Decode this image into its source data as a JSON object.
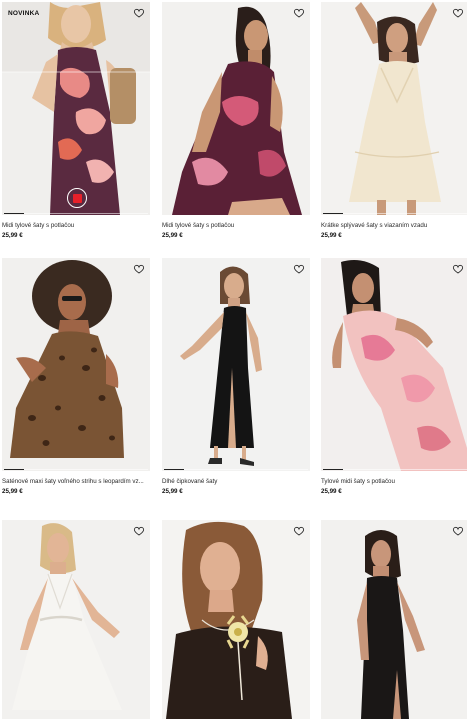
{
  "products": [
    {
      "name": "Midi tylové šaty s potlačou",
      "price": "25,99 €",
      "badge": "NOVINKA",
      "image": "woman-floral-tulle-dress",
      "progress": 0.14
    },
    {
      "name": "Midi tylové šaty s potlačou",
      "price": "25,99 €",
      "badge": "",
      "image": "woman-sitting-floral-dress",
      "progress": 0
    },
    {
      "name": "Krátke splývavé šaty s viazaním vzadu",
      "price": "25,99 €",
      "badge": "",
      "image": "woman-cream-short-dress",
      "progress": 0.14
    },
    {
      "name": "Saténové maxi šaty voľného strihu s leopardím vz...",
      "price": "25,99 €",
      "badge": "",
      "image": "woman-leopard-dress",
      "progress": 0.14
    },
    {
      "name": "Dlhé čipkované šaty",
      "price": "25,99 €",
      "badge": "",
      "image": "woman-black-lace-dress",
      "progress": 0.14
    },
    {
      "name": "Tylové midi šaty s potlačou",
      "price": "25,99 €",
      "badge": "",
      "image": "woman-pink-print-dress",
      "progress": 0.14
    },
    {
      "name": "",
      "price": "",
      "badge": "",
      "image": "woman-white-halter-dress",
      "progress": 0
    },
    {
      "name": "",
      "price": "",
      "badge": "",
      "image": "woman-black-dress-flower-necklace",
      "progress": 0
    },
    {
      "name": "",
      "price": "",
      "badge": "",
      "image": "woman-black-maxi-dress",
      "progress": 0
    }
  ],
  "icons": {
    "wishlist": "heart-outline-icon",
    "record": "record-stop-icon"
  },
  "colors": {
    "accent": "#e8202a",
    "text": "#1a1a1a"
  }
}
